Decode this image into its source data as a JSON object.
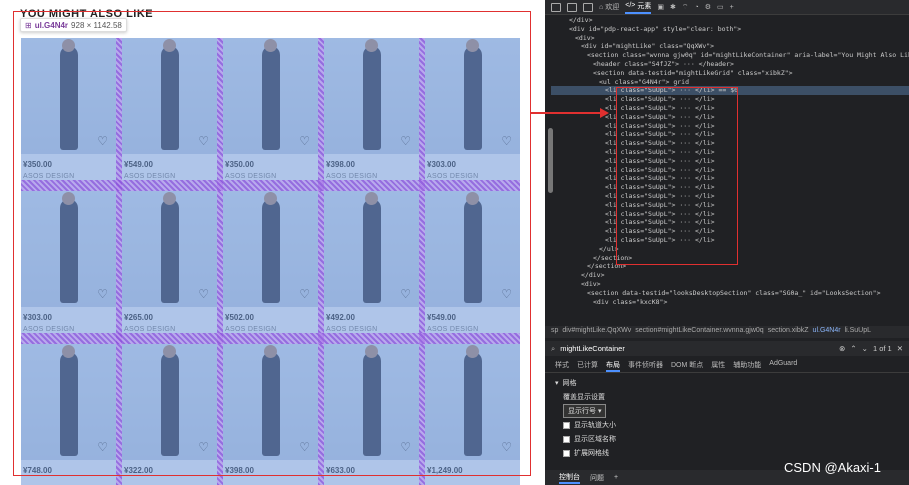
{
  "page": {
    "section_title": "YOU MIGHT ALSO LIKE",
    "tooltip": {
      "element": "ul.G4N4r",
      "size": "928 × 1142.58"
    }
  },
  "products": [
    {
      "price": "¥350.00",
      "brand": "ASOS DESIGN"
    },
    {
      "price": "¥549.00",
      "brand": "ASOS DESIGN"
    },
    {
      "price": "¥350.00",
      "brand": "ASOS DESIGN"
    },
    {
      "price": "¥398.00",
      "brand": "ASOS DESIGN"
    },
    {
      "price": "¥303.00",
      "brand": "ASOS DESIGN"
    },
    {
      "price": "¥303.00",
      "brand": "ASOS DESIGN"
    },
    {
      "price": "¥265.00",
      "brand": "ASOS DESIGN"
    },
    {
      "price": "¥502.00",
      "brand": "ASOS DESIGN"
    },
    {
      "price": "¥492.00",
      "brand": "ASOS DESIGN"
    },
    {
      "price": "¥549.00",
      "brand": "ASOS DESIGN"
    },
    {
      "price": "¥748.00",
      "brand": ""
    },
    {
      "price": "¥322.00",
      "brand": ""
    },
    {
      "price": "¥398.00",
      "brand": ""
    },
    {
      "price": "¥633.00",
      "brand": ""
    },
    {
      "price": "¥1,249.00",
      "brand": ""
    }
  ],
  "devtools": {
    "tabs": [
      "欢迎",
      "元素"
    ],
    "breadcrumbs": [
      "sp",
      "div#mightLike.QqXWv",
      "section#mightLikeContainer.wvnna.gjw0q",
      "section.xibkZ",
      "ul.G4N4r",
      "li.SuUpL"
    ],
    "search_value": "mightLikeContainer",
    "search_count": "1 of 1",
    "subtabs": [
      "样式",
      "已计算",
      "布局",
      "事件侦听器",
      "DOM 断点",
      "属性",
      "辅助功能",
      "AdGuard"
    ],
    "layout_heading": "网格",
    "overlay_heading": "覆盖显示设置",
    "select_value": "显示行号",
    "options": [
      "显示轨道大小",
      "显示区域名称",
      "扩展网格线"
    ],
    "bottom_tabs": [
      "控制台",
      "问题"
    ],
    "tree_lines": [
      "</div>",
      "<div id=\"pdp-react-app\" style=\"clear: both\">",
      "<div>",
      "<div id=\"mightLike\" class=\"QqXWv\">",
      "<section class=\"wvnna gjw0q\" id=\"mightLikeContainer\" aria-label=\"You Might Also Like Grid\">",
      "<header class=\"S4fJZ\"> ··· </header>",
      "<section data-testid=\"mightLikeGrid\" class=\"xibkZ\">",
      "<ul class=\"G4N4r\"> grid",
      "<li class=\"SuUpL\"> ··· </li> == $0",
      "<li class=\"SuUpL\"> ··· </li>",
      "<li class=\"SuUpL\"> ··· </li>",
      "<li class=\"SuUpL\"> ··· </li>",
      "<li class=\"SuUpL\"> ··· </li>",
      "<li class=\"SuUpL\"> ··· </li>",
      "<li class=\"SuUpL\"> ··· </li>",
      "<li class=\"SuUpL\"> ··· </li>",
      "<li class=\"SuUpL\"> ··· </li>",
      "<li class=\"SuUpL\"> ··· </li>",
      "<li class=\"SuUpL\"> ··· </li>",
      "<li class=\"SuUpL\"> ··· </li>",
      "<li class=\"SuUpL\"> ··· </li>",
      "<li class=\"SuUpL\"> ··· </li>",
      "<li class=\"SuUpL\"> ··· </li>",
      "<li class=\"SuUpL\"> ··· </li>",
      "<li class=\"SuUpL\"> ··· </li>",
      "<li class=\"SuUpL\"> ··· </li>",
      "</ul>",
      "</section>",
      "</section>",
      "</div>",
      "<div>",
      "<section data-testid=\"looksDesktopSection\" class=\"SG0a_\" id=\"LooksSection\">",
      "<div class=\"kxcK8\">"
    ]
  },
  "watermark": "CSDN @Akaxi-1"
}
